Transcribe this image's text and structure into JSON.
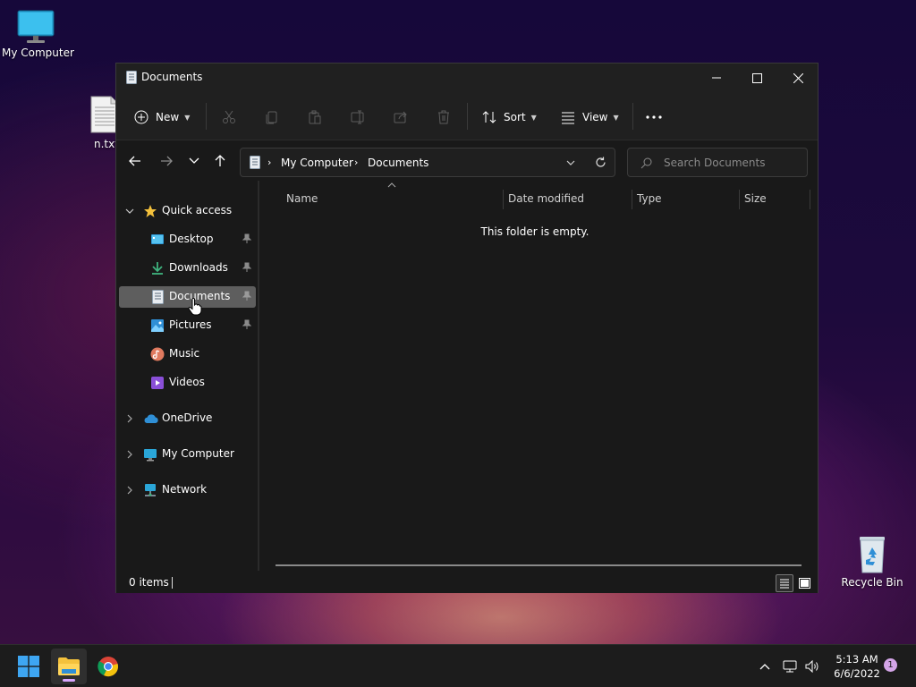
{
  "desktop": {
    "icons": [
      {
        "label": "My Computer"
      },
      {
        "label": "n.txt"
      },
      {
        "label": "Recycle Bin"
      }
    ]
  },
  "window": {
    "title": "Documents",
    "controls": {
      "minimize": "minimize-icon",
      "maximize": "maximize-icon",
      "close": "close-icon"
    }
  },
  "command_bar": {
    "new_label": "New",
    "sort_label": "Sort",
    "view_label": "View",
    "icons": [
      "cut-icon",
      "copy-icon",
      "paste-icon",
      "rename-icon",
      "share-icon",
      "delete-icon",
      "more-icon"
    ]
  },
  "navigation": {
    "breadcrumb": [
      "My Computer",
      "Documents"
    ],
    "search_placeholder": "Search Documents"
  },
  "sidebar": {
    "quick_access": "Quick access",
    "items": [
      {
        "label": "Desktop",
        "pinned": true
      },
      {
        "label": "Downloads",
        "pinned": true
      },
      {
        "label": "Documents",
        "pinned": true,
        "selected": true
      },
      {
        "label": "Pictures",
        "pinned": true
      },
      {
        "label": "Music",
        "pinned": false
      },
      {
        "label": "Videos",
        "pinned": false
      }
    ],
    "roots": [
      {
        "label": "OneDrive"
      },
      {
        "label": "My Computer"
      },
      {
        "label": "Network"
      }
    ]
  },
  "content": {
    "columns": [
      "Name",
      "Date modified",
      "Type",
      "Size"
    ],
    "empty_message": "This folder is empty."
  },
  "status": {
    "item_count": "0 items"
  },
  "taskbar": {
    "time": "5:13 AM",
    "date": "6/6/2022",
    "notification_count": "1"
  },
  "colors": {
    "accent": "#60cdff",
    "window_bg": "#191919",
    "selected_bg": "#5e5e5e",
    "folder_yellow": "#f4c13c"
  }
}
